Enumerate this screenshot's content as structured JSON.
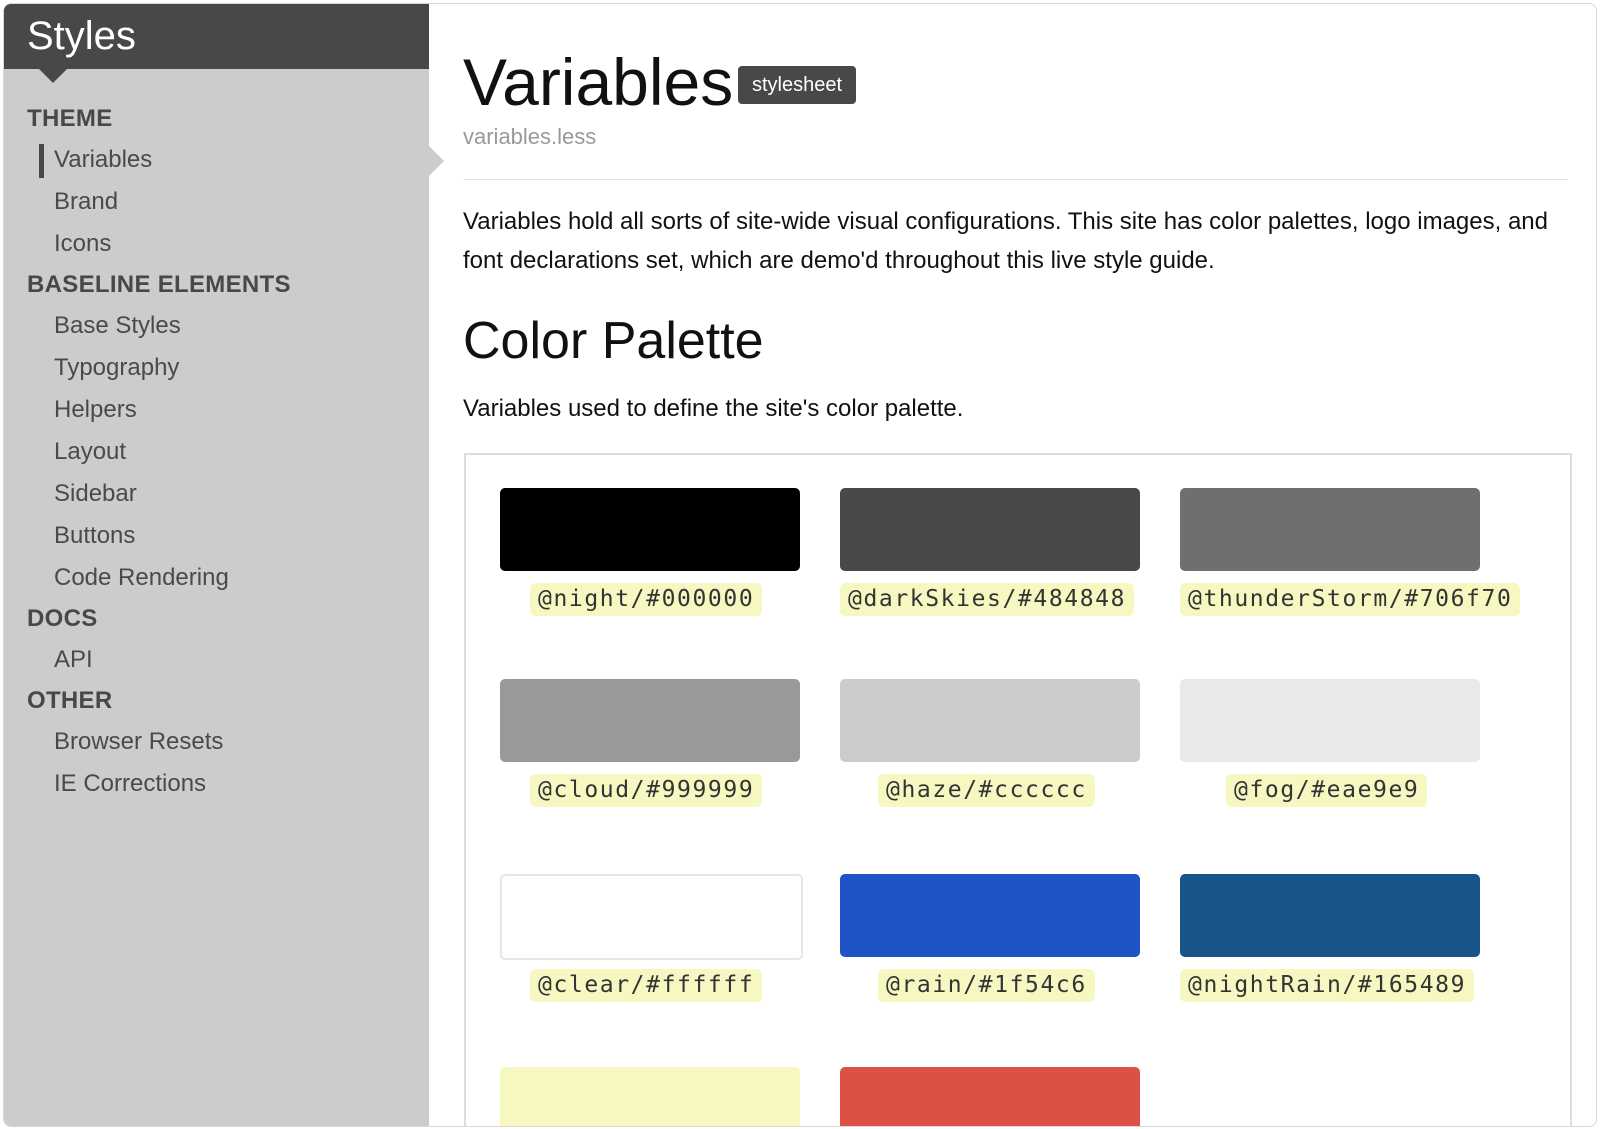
{
  "sidebar": {
    "title": "Styles",
    "groups": [
      {
        "heading": "THEME",
        "items": [
          "Variables",
          "Brand",
          "Icons"
        ]
      },
      {
        "heading": "BASELINE ELEMENTS",
        "items": [
          "Base Styles",
          "Typography",
          "Helpers",
          "Layout",
          "Sidebar",
          "Buttons",
          "Code Rendering"
        ]
      },
      {
        "heading": "DOCS",
        "items": [
          "API"
        ]
      },
      {
        "heading": "OTHER",
        "items": [
          "Browser Resets",
          "IE Corrections"
        ]
      }
    ],
    "active_item": "Variables"
  },
  "main": {
    "title": "Variables",
    "badge": "stylesheet",
    "filename": "variables.less",
    "intro": "Variables hold all sorts of site-wide visual configurations. This site has color palettes, logo images, and font declarations set, which are demo'd throughout this live style guide.",
    "section_title": "Color Palette",
    "section_desc": "Variables used to define the site's color palette."
  },
  "palette": [
    {
      "label": "@night/#000000",
      "color": "#000000"
    },
    {
      "label": "@darkSkies/#484848",
      "color": "#484848"
    },
    {
      "label": "@thunderStorm/#706f70",
      "color": "#706f70"
    },
    {
      "label": "@cloud/#999999",
      "color": "#999999"
    },
    {
      "label": "@haze/#cccccc",
      "color": "#cccccc"
    },
    {
      "label": "@fog/#eae9e9",
      "color": "#eae9e9"
    },
    {
      "label": "@clear/#ffffff",
      "color": "#ffffff"
    },
    {
      "label": "@rain/#1f54c6",
      "color": "#1f54c6"
    },
    {
      "label": "@nightRain/#165489",
      "color": "#165489"
    },
    {
      "label": "",
      "color": "#f7f7c2"
    },
    {
      "label": "",
      "color": "#dd5046"
    }
  ]
}
